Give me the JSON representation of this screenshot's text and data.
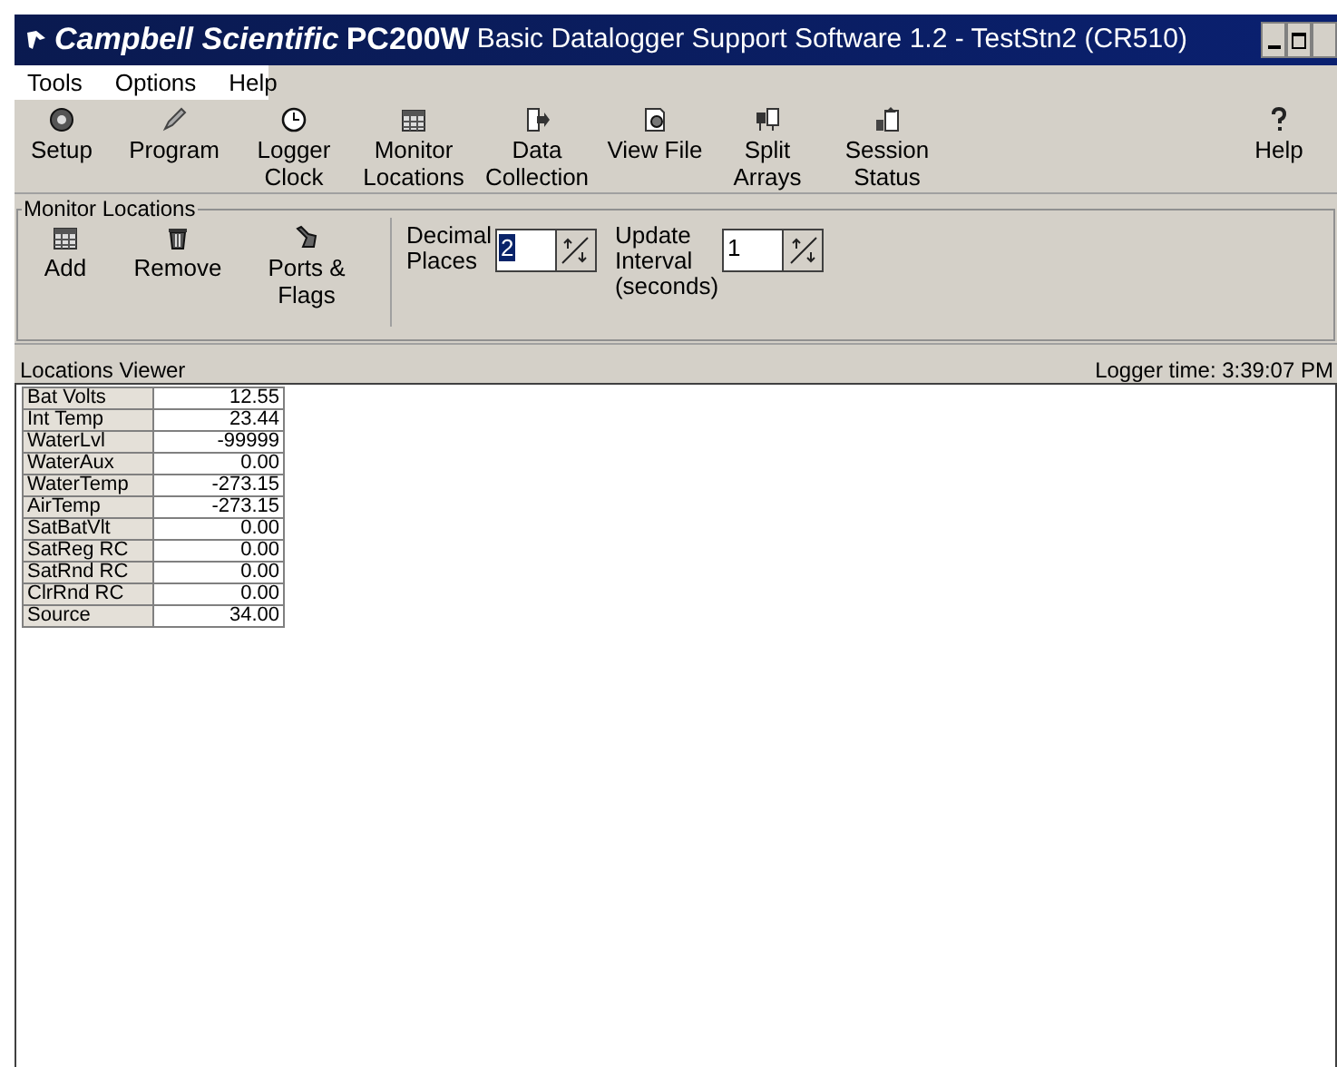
{
  "window": {
    "brand": "Campbell Scientific",
    "product": "PC200W",
    "title": "Basic Datalogger Support Software 1.2  - TestStn2 (CR510)"
  },
  "menu": [
    "Tools",
    "Options",
    "Help"
  ],
  "toolbar": [
    {
      "kind": "setup",
      "label": "Setup"
    },
    {
      "kind": "program",
      "label": "Program"
    },
    {
      "kind": "clock",
      "label": "Logger\nClock"
    },
    {
      "kind": "grid",
      "label": "Monitor\nLocations"
    },
    {
      "kind": "export",
      "label": "Data\nCollection"
    },
    {
      "kind": "file",
      "label": "View File"
    },
    {
      "kind": "split",
      "label": "Split\nArrays"
    },
    {
      "kind": "status",
      "label": "Session\nStatus"
    },
    {
      "kind": "help",
      "label": "Help"
    }
  ],
  "monitor": {
    "title": "Monitor Locations",
    "buttons": [
      {
        "kind": "grid",
        "label": "Add"
      },
      {
        "kind": "remove",
        "label": "Remove"
      },
      {
        "kind": "ports",
        "label": "Ports &\nFlags"
      }
    ],
    "decimal": {
      "label": "Decimal\nPlaces",
      "value": "2",
      "selected": true
    },
    "interval": {
      "label": "Update\nInterval\n(seconds)",
      "value": "1",
      "selected": false
    }
  },
  "viewer": {
    "title": "Locations Viewer",
    "logger_time": "Logger time: 3:39:07 PM",
    "rows": [
      {
        "name": "Bat Volts",
        "value": "12.55"
      },
      {
        "name": "Int Temp",
        "value": "23.44"
      },
      {
        "name": "WaterLvl",
        "value": "-99999"
      },
      {
        "name": "WaterAux",
        "value": "0.00"
      },
      {
        "name": "WaterTemp",
        "value": "-273.15"
      },
      {
        "name": "AirTemp",
        "value": "-273.15"
      },
      {
        "name": "SatBatVlt",
        "value": "0.00"
      },
      {
        "name": "SatReg RC",
        "value": "0.00"
      },
      {
        "name": "SatRnd RC",
        "value": "0.00"
      },
      {
        "name": "ClrRnd RC",
        "value": "0.00"
      },
      {
        "name": "Source",
        "value": "34.00"
      }
    ]
  }
}
